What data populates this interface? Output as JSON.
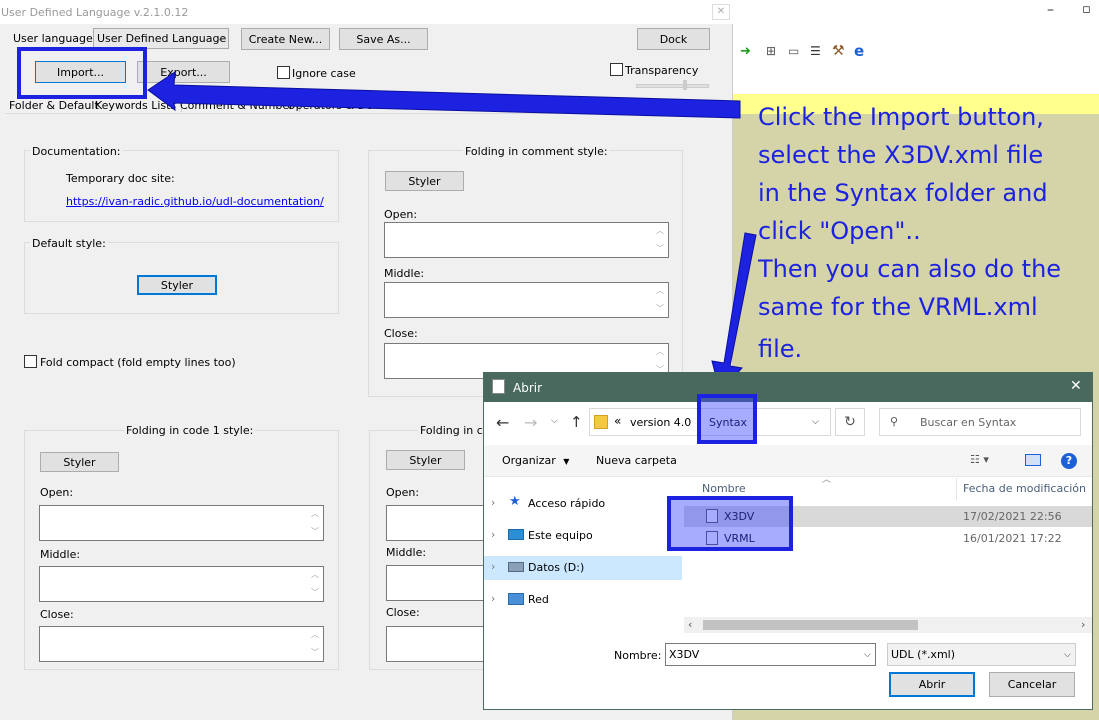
{
  "udl": {
    "title": "User Defined Language v.2.1.0.12",
    "user_language_label": "User language :",
    "user_language_value": "User Defined Language",
    "create_new": "Create New...",
    "save_as": "Save As...",
    "dock": "Dock",
    "import": "Import...",
    "export": "Export...",
    "ignore_case": "Ignore case",
    "transparency": "Transparency",
    "tabs": [
      "Folder & Default",
      "Keywords Lists",
      "Comment & Number",
      "Operators & Delimiters"
    ],
    "documentation": {
      "label": "Documentation:",
      "temp_site": "Temporary doc site:",
      "link": "https://ivan-radic.github.io/udl-documentation/"
    },
    "default_style": {
      "label": "Default style:",
      "styler": "Styler"
    },
    "fold_compact": "Fold compact (fold empty lines too)",
    "comment_folding": {
      "title": "Folding in comment style:",
      "styler": "Styler",
      "open": "Open:",
      "middle": "Middle:",
      "close": "Close:"
    },
    "code1_folding": {
      "title": "Folding in code 1 style:",
      "styler": "Styler",
      "open": "Open:",
      "middle": "Middle:",
      "close": "Close:"
    },
    "code2_folding": {
      "title": "Folding in co",
      "styler": "Styler",
      "open": "Open:",
      "middle": "Middle:",
      "close": "Close:"
    }
  },
  "annotation": {
    "lines": [
      "Click the Import button,",
      "select the X3DV.xml file",
      "in the Syntax folder and",
      "click \"Open\"..",
      "Then you can also do the",
      "same for the VRML.xml",
      "file."
    ],
    "color": "#1c22e0",
    "panel_color": "#d4d4a8"
  },
  "dialog": {
    "title": "Abrir",
    "path_prefix": "«",
    "path_folder": "version 4.0",
    "path_current": "Syntax",
    "search_placeholder": "Buscar en Syntax",
    "organize": "Organizar",
    "new_folder": "Nueva carpeta",
    "col_name": "Nombre",
    "col_date": "Fecha de modificación",
    "nav": [
      "Acceso rápido",
      "Este equipo",
      "Datos (D:)",
      "Red"
    ],
    "files": [
      {
        "name": "X3DV",
        "date": "17/02/2021 22:56"
      },
      {
        "name": "VRML",
        "date": "16/01/2021 17:22"
      }
    ],
    "filename_label": "Nombre:",
    "filename_value": "X3DV",
    "filter_value": "UDL (*.xml)",
    "open_btn": "Abrir",
    "cancel_btn": "Cancelar"
  }
}
